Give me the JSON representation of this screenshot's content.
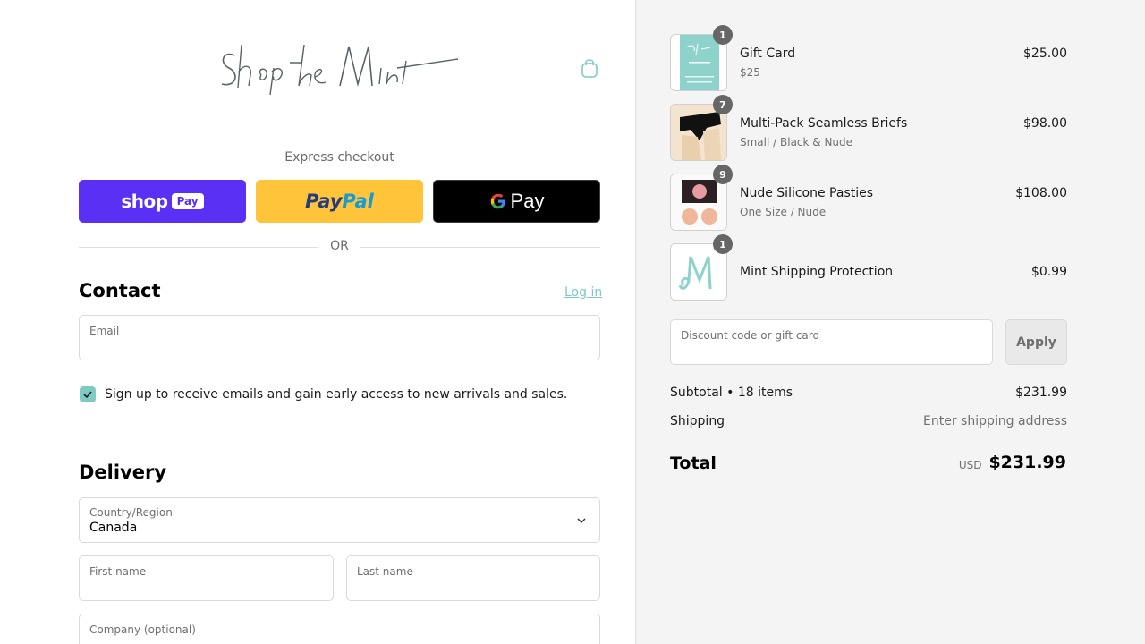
{
  "brand": {
    "logo_text": "Shop the Mint",
    "accent_color": "#7fcac3"
  },
  "header": {
    "cart_icon": "shopping-bag-icon"
  },
  "express": {
    "label": "Express checkout",
    "shop_pay": {
      "shop": "shop",
      "pay": "Pay",
      "color": "#5a31f4"
    },
    "paypal": {
      "part1": "Pay",
      "part2": "Pal",
      "color": "#ffc439"
    },
    "gpay": {
      "label": "Pay",
      "color": "#000000"
    },
    "or_label": "OR"
  },
  "contact": {
    "title": "Contact",
    "login_label": "Log in",
    "email": {
      "label": "Email",
      "value": ""
    },
    "newsletter": {
      "checked": true,
      "label": "Sign up to receive emails and gain early access to new arrivals and sales."
    }
  },
  "delivery": {
    "title": "Delivery",
    "country": {
      "label": "Country/Region",
      "value": "Canada"
    },
    "first_name": {
      "label": "First name",
      "value": ""
    },
    "last_name": {
      "label": "Last name",
      "value": ""
    },
    "company": {
      "label": "Company (optional)",
      "value": ""
    }
  },
  "cart": {
    "items": [
      {
        "name": "Gift Card",
        "variant": "$25",
        "quantity": "1",
        "price": "$25.00"
      },
      {
        "name": "Multi-Pack Seamless Briefs",
        "variant": "Small / Black & Nude",
        "quantity": "7",
        "price": "$98.00"
      },
      {
        "name": "Nude Silicone Pasties",
        "variant": "One Size / Nude",
        "quantity": "9",
        "price": "$108.00"
      },
      {
        "name": "Mint Shipping Protection",
        "variant": "",
        "quantity": "1",
        "price": "$0.99"
      }
    ],
    "discount": {
      "label": "Discount code or gift card",
      "value": "",
      "apply_label": "Apply"
    },
    "subtotal": {
      "label": "Subtotal • 18 items",
      "value": "$231.99"
    },
    "shipping": {
      "label": "Shipping",
      "value": "Enter shipping address"
    },
    "total": {
      "label": "Total",
      "currency": "USD",
      "value": "$231.99"
    }
  }
}
